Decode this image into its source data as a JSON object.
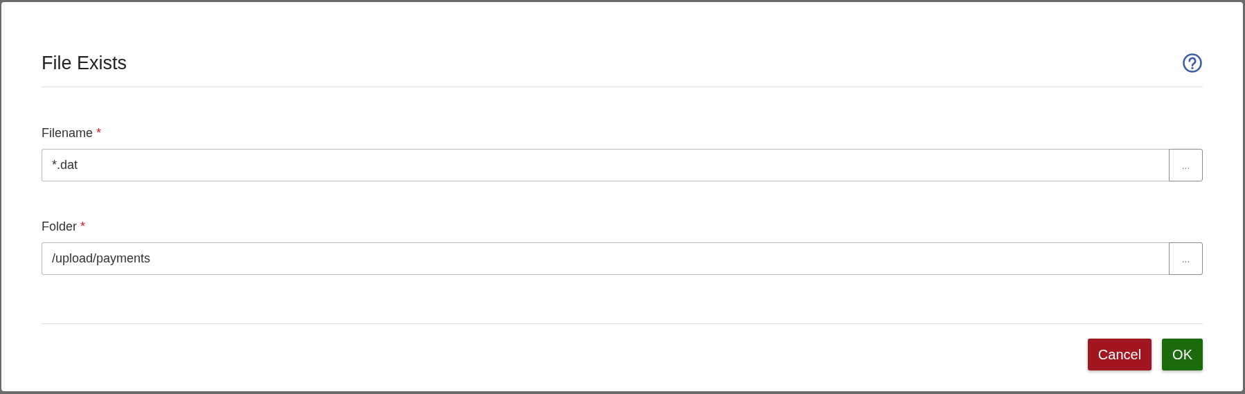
{
  "dialog": {
    "title": "File Exists"
  },
  "fields": [
    {
      "label": "Filename",
      "required_mark": "*",
      "value": "*.dat",
      "browse": "..."
    },
    {
      "label": "Folder",
      "required_mark": "*",
      "value": "/upload/payments",
      "browse": "..."
    }
  ],
  "buttons": [
    {
      "label": "Cancel",
      "kind": "danger"
    },
    {
      "label": "OK",
      "kind": "success"
    }
  ]
}
